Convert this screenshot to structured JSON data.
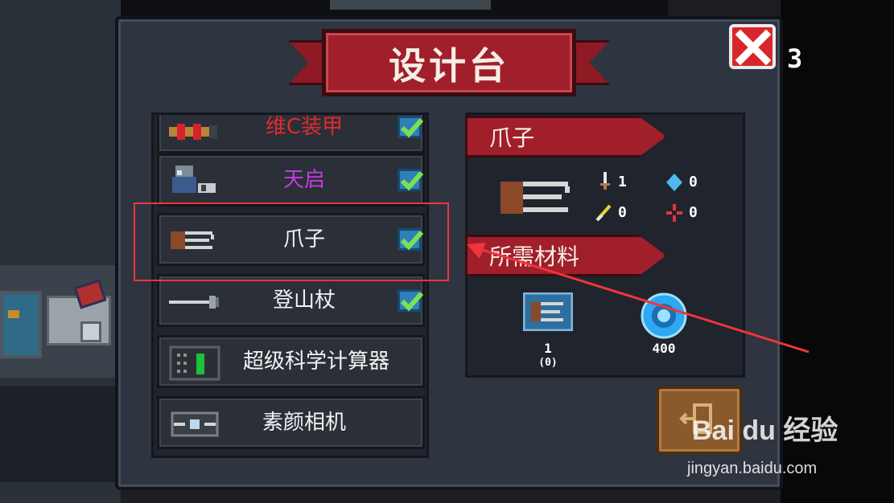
{
  "title": "设计台",
  "close_count": "3",
  "list_items": [
    {
      "label": "维C装甲",
      "color": "#e2292f",
      "checked": true,
      "icon": "vitamin-armor-icon"
    },
    {
      "label": "天启",
      "color": "#c23cdd",
      "checked": true,
      "icon": "mech-apocalypse-icon"
    },
    {
      "label": "爪子",
      "color": "#f2f2f2",
      "checked": true,
      "icon": "claw-weapon-icon"
    },
    {
      "label": "登山杖",
      "color": "#f2f2f2",
      "checked": true,
      "icon": "hiking-pole-icon"
    },
    {
      "label": "超级科学计算器",
      "color": "#f2f2f2",
      "checked": false,
      "icon": "calculator-icon"
    },
    {
      "label": "素颜相机",
      "color": "#f2f2f2",
      "checked": false,
      "icon": "camera-icon"
    }
  ],
  "detail": {
    "name": "爪子",
    "weapon_icon": "claw-weapon-icon",
    "stats": [
      {
        "icon": "damage-sword-icon",
        "value": "1"
      },
      {
        "icon": "energy-crystal-icon",
        "value": "0"
      },
      {
        "icon": "crit-icon",
        "value": "0"
      },
      {
        "icon": "accuracy-crosshair-icon",
        "value": "0"
      }
    ],
    "materials_title": "所需材料",
    "materials": [
      {
        "icon": "claw-blueprint-icon",
        "count_top": "1",
        "count_bottom": "(0)"
      },
      {
        "icon": "gem-coin-icon",
        "count_top": "400",
        "count_bottom": ""
      }
    ]
  },
  "back_button_icon": "exit-door-icon",
  "watermark": {
    "logo": "Bai du 经验",
    "url": "jingyan.baidu.com"
  },
  "colors": {
    "ribbon": "#a01f2b",
    "panel": "#2e3440",
    "highlight": "#f0353b",
    "check": "#2f80b8"
  }
}
